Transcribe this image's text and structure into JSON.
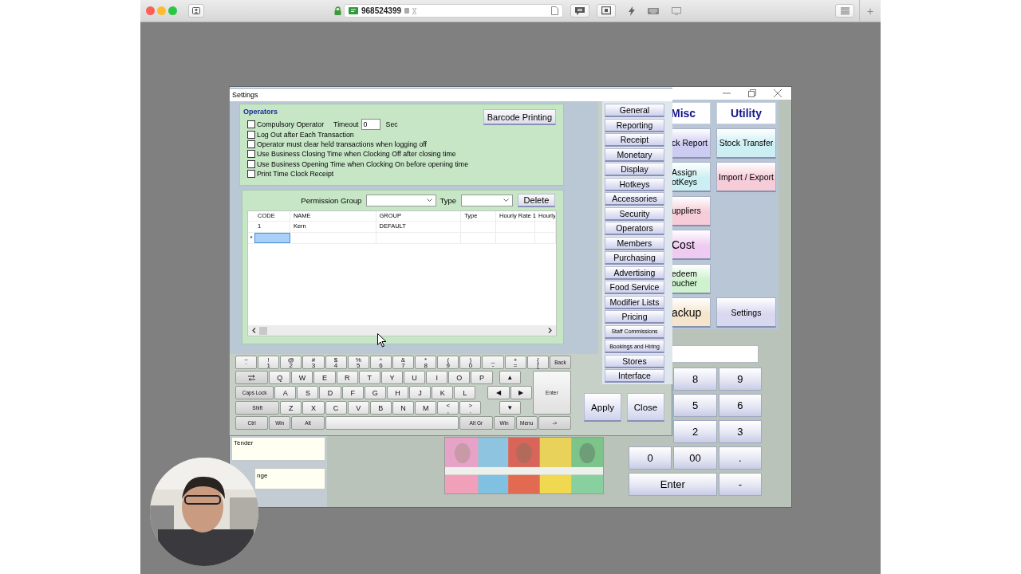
{
  "browser": {
    "address": "968524399",
    "new_tab": "+"
  },
  "pos": {
    "headers": [
      {
        "label": "Misc"
      },
      {
        "label": "Utility"
      }
    ],
    "function_rows": [
      [
        {
          "label": "ck Report",
          "color": "#cccbf2",
          "kind": "normal"
        },
        {
          "label": "Stock Transfer",
          "color": "#cbeff2",
          "kind": "normal"
        }
      ],
      [
        {
          "label": "Assign\notKeys",
          "color": "#cbeff2",
          "kind": "normal"
        },
        {
          "label": "Import / Export",
          "color": "#f5ccd8",
          "kind": "normal"
        }
      ],
      [
        {
          "label": "uppliers",
          "color": "#f5ccd8",
          "kind": "normal"
        }
      ],
      [
        {
          "label": "Cost",
          "color": "#efcbf2",
          "kind": "large"
        }
      ],
      [
        {
          "label": "edeem\noucher",
          "color": "#cdf2cd",
          "kind": "normal"
        }
      ],
      [
        {
          "label": "ackup",
          "color": "#f5e5cc",
          "kind": "large"
        },
        {
          "label": "Settings",
          "color": "#d8d8f0",
          "kind": "normal"
        }
      ]
    ],
    "keypad": [
      {
        "keys": [
          {
            "label": "8",
            "kind": "key"
          },
          {
            "label": "9",
            "kind": "key"
          }
        ]
      },
      {
        "keys": [
          {
            "label": "5",
            "kind": "key"
          },
          {
            "label": "6",
            "kind": "key"
          }
        ]
      },
      {
        "keys": [
          {
            "label": "2",
            "kind": "key"
          },
          {
            "label": "3",
            "kind": "key"
          }
        ]
      },
      {
        "keys": [
          {
            "label": "0",
            "kind": "key"
          },
          {
            "label": "00",
            "kind": "key"
          },
          {
            "label": ".",
            "kind": "key"
          }
        ]
      },
      {
        "keys": [
          {
            "label": "Enter",
            "kind": "wide"
          },
          {
            "label": "-",
            "kind": "key"
          }
        ]
      }
    ],
    "tender_label": "Tender",
    "change_label": "nge"
  },
  "settings": {
    "title": "Settings",
    "operators": {
      "heading": "Operators",
      "timeout_label": "Timeout",
      "timeout_value": "0",
      "timeout_unit": "Sec",
      "barcode_button": "Barcode Printing",
      "options": [
        {
          "label": "Compulsory Operator",
          "checked": false
        },
        {
          "label": "Log Out after Each Transaction",
          "checked": false
        },
        {
          "label": "Operator must clear held transactions when logging off",
          "checked": false
        },
        {
          "label": "Use Business Closing Time when Clocking Off after closing time",
          "checked": false
        },
        {
          "label": "Use Business Opening Time when Clocking On before opening time",
          "checked": false
        },
        {
          "label": "Print Time Clock Receipt",
          "checked": false
        }
      ]
    },
    "permissions": {
      "group_label": "Permission Group",
      "type_label": "Type",
      "delete_button": "Delete",
      "columns": [
        "CODE",
        "NAME",
        "GROUP",
        "Type",
        "Hourly Rate 1",
        "Hourly"
      ],
      "rows": [
        {
          "cells": [
            "1",
            "Kern",
            "DEFAULT"
          ]
        }
      ],
      "new_row": {
        "marker": "*",
        "focused": true
      }
    },
    "sections": [
      {
        "label": "General",
        "kind": "normal"
      },
      {
        "label": "Reporting",
        "kind": "normal"
      },
      {
        "label": "Receipt",
        "kind": "normal"
      },
      {
        "label": "Monetary",
        "kind": "normal"
      },
      {
        "label": "Display",
        "kind": "normal"
      },
      {
        "label": "Hotkeys",
        "kind": "normal"
      },
      {
        "label": "Accessories",
        "kind": "normal"
      },
      {
        "label": "Security",
        "kind": "normal"
      },
      {
        "label": "Operators",
        "kind": "normal"
      },
      {
        "label": "Members",
        "kind": "normal"
      },
      {
        "label": "Purchasing",
        "kind": "normal"
      },
      {
        "label": "Advertising",
        "kind": "normal"
      },
      {
        "label": "Food Service",
        "kind": "normal"
      },
      {
        "label": "Modifier Lists",
        "kind": "normal"
      },
      {
        "label": "Pricing",
        "kind": "normal"
      },
      {
        "label": "Staff Commissions",
        "kind": "small"
      },
      {
        "label": "Bookings and Hiring",
        "kind": "small"
      },
      {
        "label": "Stores",
        "kind": "normal"
      },
      {
        "label": "Interface",
        "kind": "normal"
      }
    ],
    "keyboard": [
      {
        "keys": [
          {
            "label": "`",
            "alt": "~",
            "kind": "dual"
          },
          {
            "label": "1",
            "alt": "!",
            "kind": "dual"
          },
          {
            "label": "2",
            "alt": "@",
            "kind": "dual"
          },
          {
            "label": "3",
            "alt": "#",
            "kind": "dual"
          },
          {
            "label": "4",
            "alt": "$",
            "kind": "dual"
          },
          {
            "label": "5",
            "alt": "%",
            "kind": "dual"
          },
          {
            "label": "6",
            "alt": "^",
            "kind": "dual"
          },
          {
            "label": "7",
            "alt": "&",
            "kind": "dual"
          },
          {
            "label": "8",
            "alt": "*",
            "kind": "dual"
          },
          {
            "label": "9",
            "alt": "(",
            "kind": "dual"
          },
          {
            "label": "0",
            "alt": ")",
            "kind": "dual"
          },
          {
            "label": "-",
            "alt": "_",
            "kind": "dual"
          },
          {
            "label": "=",
            "alt": "+",
            "kind": "dual"
          },
          {
            "label": "[",
            "alt": "{",
            "kind": "dual"
          },
          {
            "label": "Back",
            "kind": "mod"
          }
        ]
      },
      {
        "keys": [
          {
            "kind": "tab"
          },
          {
            "label": "Q",
            "kind": "char"
          },
          {
            "label": "W",
            "kind": "char"
          },
          {
            "label": "E",
            "kind": "char"
          },
          {
            "label": "R",
            "kind": "char"
          },
          {
            "label": "T",
            "kind": "char"
          },
          {
            "label": "Y",
            "kind": "char"
          },
          {
            "label": "U",
            "kind": "char"
          },
          {
            "label": "I",
            "kind": "char"
          },
          {
            "label": "O",
            "kind": "char"
          },
          {
            "label": "P",
            "kind": "char"
          },
          {
            "label": "▲",
            "kind": "arrow"
          },
          {
            "label": "Enter",
            "kind": "enter"
          }
        ]
      },
      {
        "keys": [
          {
            "label": "Caps Lock",
            "kind": "mod"
          },
          {
            "label": "A",
            "kind": "char"
          },
          {
            "label": "S",
            "kind": "char"
          },
          {
            "label": "D",
            "kind": "char"
          },
          {
            "label": "F",
            "kind": "char"
          },
          {
            "label": "G",
            "kind": "char"
          },
          {
            "label": "H",
            "kind": "char"
          },
          {
            "label": "J",
            "kind": "char"
          },
          {
            "label": "K",
            "kind": "char"
          },
          {
            "label": "L",
            "kind": "char"
          },
          {
            "label": "◀",
            "kind": "arrow"
          },
          {
            "label": "▶",
            "kind": "arrow"
          }
        ]
      },
      {
        "keys": [
          {
            "label": "Shift",
            "kind": "mod"
          },
          {
            "label": "Z",
            "kind": "char"
          },
          {
            "label": "X",
            "kind": "char"
          },
          {
            "label": "C",
            "kind": "char"
          },
          {
            "label": "V",
            "kind": "char"
          },
          {
            "label": "B",
            "kind": "char"
          },
          {
            "label": "N",
            "kind": "char"
          },
          {
            "label": "M",
            "kind": "char"
          },
          {
            "label": ",",
            "alt": "<",
            "kind": "dual"
          },
          {
            "label": ".",
            "alt": ">",
            "kind": "dual"
          },
          {
            "label": "▼",
            "kind": "arrow"
          }
        ]
      },
      {
        "keys": [
          {
            "label": "Ctrl",
            "kind": "mod"
          },
          {
            "label": "Win",
            "kind": "mod"
          },
          {
            "label": "Alt",
            "kind": "mod"
          },
          {
            "kind": "space"
          },
          {
            "label": "Alt Gr",
            "kind": "mod"
          },
          {
            "label": "Win",
            "kind": "mod"
          },
          {
            "label": "Menu",
            "kind": "mod"
          },
          {
            "label": "->",
            "kind": "mod"
          }
        ]
      }
    ],
    "apply_button": "Apply",
    "close_button": "Close"
  }
}
